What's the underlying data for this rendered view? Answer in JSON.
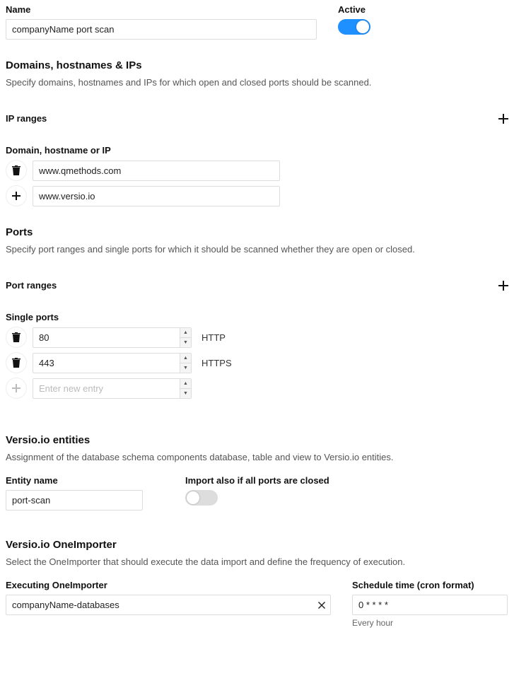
{
  "top": {
    "name_label": "Name",
    "name_value": "companyName port scan",
    "active_label": "Active",
    "active": true
  },
  "domains_section": {
    "title": "Domains, hostnames & IPs",
    "desc": "Specify domains, hostnames and IPs for which open and closed ports should be scanned."
  },
  "ip_ranges": {
    "label": "IP ranges"
  },
  "host_list": {
    "label": "Domain, hostname or IP",
    "items": [
      {
        "value": "www.qmethods.com"
      },
      {
        "value": "www.versio.io"
      }
    ]
  },
  "ports_section": {
    "title": "Ports",
    "desc": "Specify port ranges and single ports for which it should be scanned whether they are open or closed."
  },
  "port_ranges": {
    "label": "Port ranges"
  },
  "single_ports": {
    "label": "Single ports",
    "items": [
      {
        "value": "80",
        "proto": "HTTP"
      },
      {
        "value": "443",
        "proto": "HTTPS"
      }
    ],
    "new_placeholder": "Enter new entry"
  },
  "entities": {
    "title": "Versio.io entities",
    "desc": "Assignment of the database schema components database, table and view to Versio.io entities.",
    "entity_label": "Entity name",
    "entity_value": "port-scan",
    "import_label": "Import also if all ports are closed",
    "import_enabled": false
  },
  "oneimporter": {
    "title": "Versio.io OneImporter",
    "desc": "Select the OneImporter that should execute the data import and define the frequency of execution.",
    "exec_label": "Executing OneImporter",
    "exec_value": "companyName-databases",
    "cron_label": "Schedule time (cron format)",
    "cron_value": "0 * * * *",
    "cron_human": "Every hour"
  }
}
